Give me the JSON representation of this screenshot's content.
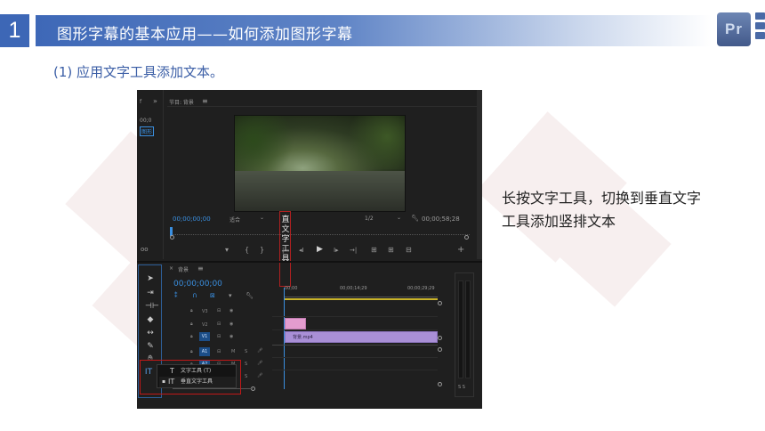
{
  "slide": {
    "section_number": "1",
    "title": "图形字幕的基本应用——如何添加图形字幕",
    "subtitle": "(1) 应用文字工具添加文本。",
    "logo": "Pr",
    "caption": "长按文字工具，切换到垂直文字工具添加竖排文本"
  },
  "premiere": {
    "program_panel_title": "节目: 背景",
    "menu_icon": "≡",
    "double_chevron": "»",
    "left_panel_code": "00;0",
    "left_panel_thumb": "图形",
    "video_overlay_text": "直文字工具",
    "timecode_left": "00;00;00;00",
    "fit_label": "适合",
    "resolution": "1/2",
    "timecode_right": "00;00;58;28",
    "playback_buttons": [
      "▾",
      "{",
      "}",
      "|←",
      "◂I",
      "▶",
      "I▸",
      "→|",
      "⊞",
      "⊞",
      "⊟",
      "+"
    ],
    "timeline_title": "背景",
    "timeline_timecode": "00;00;00;00",
    "ruler": [
      "00;00",
      "00;00;14;29",
      "00;00;29;29"
    ],
    "tracks": [
      {
        "name": "V3",
        "type": "video"
      },
      {
        "name": "V2",
        "type": "video"
      },
      {
        "name": "V1",
        "type": "video"
      },
      {
        "name": "A1",
        "type": "audio"
      },
      {
        "name": "A2",
        "type": "audio"
      },
      {
        "name": "A3",
        "type": "audio"
      }
    ],
    "clip_label": "背景.mp4",
    "audio_meter_label": "S S",
    "popup_items": [
      {
        "label": "文字工具 (T)",
        "shortcut": ""
      },
      {
        "label": "垂直文字工具",
        "shortcut": ""
      }
    ],
    "tools": [
      "select-arrow",
      "track-select",
      "ripple-edit",
      "razor",
      "slip",
      "pen",
      "hand",
      "type"
    ],
    "colors": {
      "accent_blue": "#3a8fe0",
      "title_blue": "#3d67b6",
      "clip_purple": "#a98fd6",
      "clip_pink": "#e49ccf",
      "highlight_red": "#c01818"
    }
  }
}
